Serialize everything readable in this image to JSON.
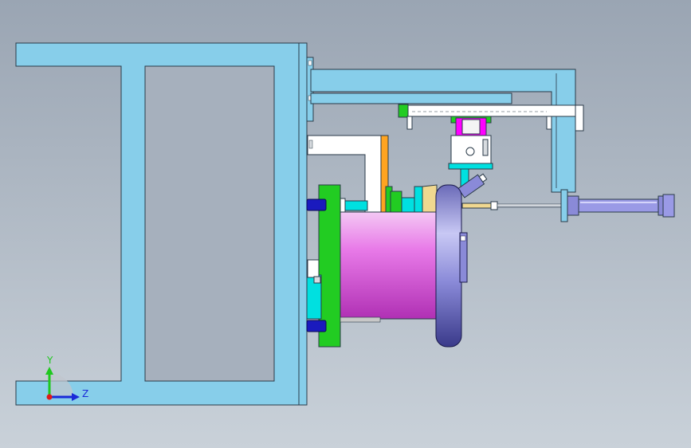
{
  "view": {
    "background_top": "#9aa5b3",
    "background_bottom": "#c9d1d9"
  },
  "colors": {
    "frame": "#87ceea",
    "frame_edge": "#2a3a48",
    "green_plate": "#22cc22",
    "magenta": "#e87ae8",
    "lavender": "#8a8ad8",
    "white_part": "#ffffff",
    "orange_part": "#ffa420",
    "cyan_part": "#00e0e0",
    "dark_blue": "#1a1abe",
    "cylinder": "#9a9ae6",
    "hot_pink": "#ff00ff"
  },
  "triad": {
    "y_label": "Y",
    "z_label": "Z",
    "y_color": "#1ec81e",
    "z_color": "#1a2ad8",
    "origin_color": "#e01818"
  }
}
